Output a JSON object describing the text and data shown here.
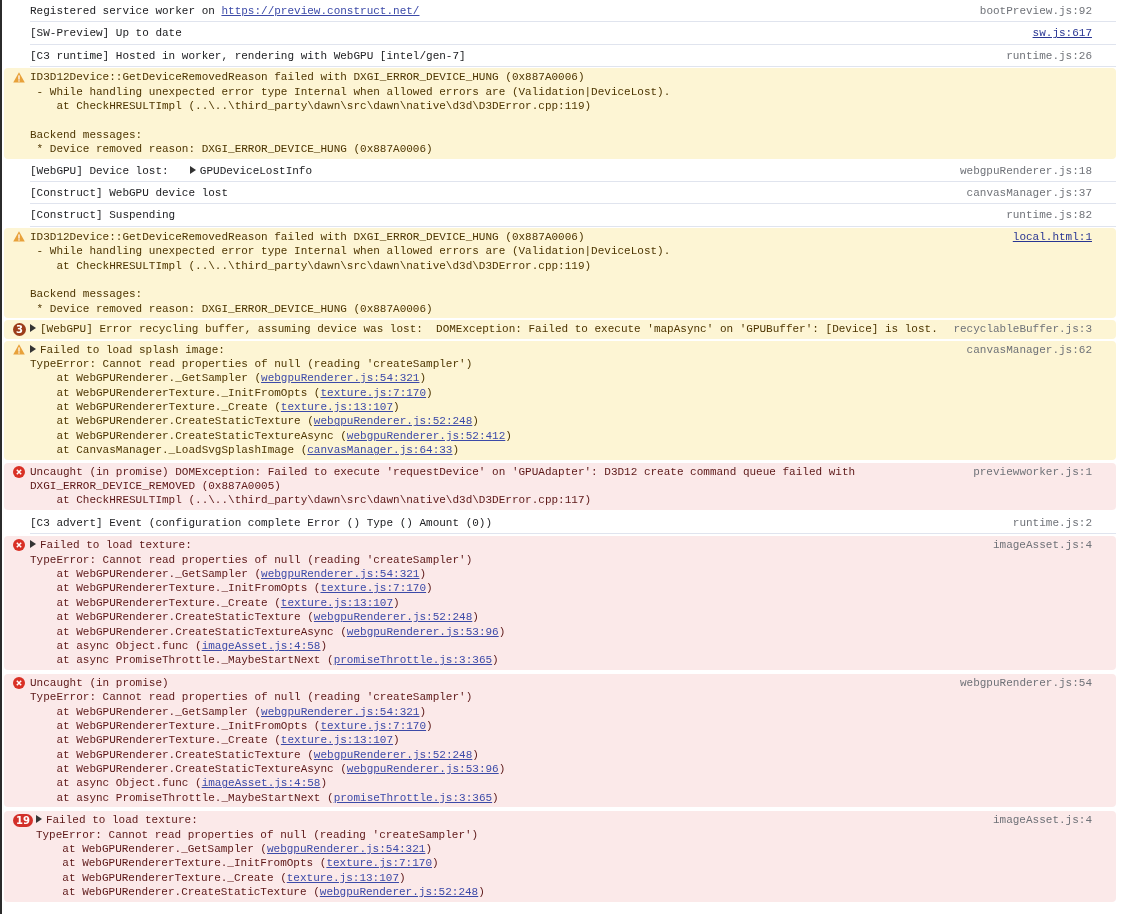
{
  "messages": [
    {
      "kind": "info",
      "paragraphs": [
        [
          [
            "Registered service worker on ",
            {
              "link": "https://preview.construct.net/"
            }
          ]
        ]
      ],
      "source": "bootPreview.js:92",
      "source_link": false
    },
    {
      "kind": "info",
      "paragraphs": [
        [
          [
            "[SW-Preview] Up to date"
          ]
        ]
      ],
      "source": "sw.js:617",
      "source_link": true
    },
    {
      "kind": "info",
      "paragraphs": [
        [
          [
            "[C3 runtime] Hosted in worker, rendering with WebGPU [intel/gen-7]"
          ]
        ]
      ],
      "source": "runtime.js:26",
      "source_link": false
    },
    {
      "kind": "warning",
      "paragraphs": [
        [
          [
            "ID3D12Device::GetDeviceRemovedReason failed with DXGI_ERROR_DEVICE_HUNG (0x887A0006)"
          ],
          [
            " - While handling unexpected error type Internal when allowed errors are (Validation|DeviceLost)."
          ],
          [
            "    at CheckHRESULTImpl (..\\..\\third_party\\dawn\\src\\dawn\\native\\d3d\\D3DError.cpp:119)"
          ]
        ],
        [
          [
            "Backend messages:"
          ],
          [
            " * Device removed reason: DXGI_ERROR_DEVICE_HUNG (0x887A0006)"
          ]
        ]
      ]
    },
    {
      "kind": "info",
      "paragraphs": [
        [
          [
            "[WebGPU] Device lost:  ",
            {
              "object": "GPUDeviceLostInfo",
              "expanded": false
            }
          ]
        ]
      ],
      "source": "webgpuRenderer.js:18",
      "source_link": false
    },
    {
      "kind": "info",
      "paragraphs": [
        [
          [
            "[Construct] WebGPU device lost"
          ]
        ]
      ],
      "source": "canvasManager.js:37",
      "source_link": false
    },
    {
      "kind": "info",
      "paragraphs": [
        [
          [
            "[Construct] Suspending"
          ]
        ]
      ],
      "source": "runtime.js:82",
      "source_link": false
    },
    {
      "kind": "warning",
      "paragraphs": [
        [
          [
            "ID3D12Device::GetDeviceRemovedReason failed with DXGI_ERROR_DEVICE_HUNG (0x887A0006)"
          ],
          [
            " - While handling unexpected error type Internal when allowed errors are (Validation|DeviceLost)."
          ],
          [
            "    at CheckHRESULTImpl (..\\..\\third_party\\dawn\\src\\dawn\\native\\d3d\\D3DError.cpp:119)"
          ]
        ],
        [
          [
            "Backend messages:"
          ],
          [
            " * Device removed reason: DXGI_ERROR_DEVICE_HUNG (0x887A0006)"
          ]
        ]
      ],
      "source": "local.html:1",
      "source_link": true
    },
    {
      "kind": "warning",
      "count": "3",
      "expanded": false,
      "paragraphs": [
        [
          [
            "[WebGPU] Error recycling buffer, assuming device was lost:  DOMException: Failed to execute 'mapAsync' on 'GPUBuffer': [Device] is lost."
          ]
        ]
      ],
      "source": "recyclableBuffer.js:3",
      "source_link": false
    },
    {
      "kind": "warning",
      "expanded": false,
      "paragraphs": [
        [
          [
            "Failed to load splash image:"
          ],
          [
            "TypeError: Cannot read properties of null (reading 'createSampler')"
          ],
          [
            "    at WebGPURenderer._GetSampler (",
            {
              "link": "webgpuRenderer.js:54:321"
            },
            ")"
          ],
          [
            "    at WebGPURendererTexture._InitFromOpts (",
            {
              "link": "texture.js:7:170"
            },
            ")"
          ],
          [
            "    at WebGPURendererTexture._Create (",
            {
              "link": "texture.js:13:107"
            },
            ")"
          ],
          [
            "    at WebGPURenderer.CreateStaticTexture (",
            {
              "link": "webgpuRenderer.js:52:248"
            },
            ")"
          ],
          [
            "    at WebGPURenderer.CreateStaticTextureAsync (",
            {
              "link": "webgpuRenderer.js:52:412"
            },
            ")"
          ],
          [
            "    at CanvasManager._LoadSvgSplashImage (",
            {
              "link": "canvasManager.js:64:33"
            },
            ")"
          ]
        ]
      ],
      "source": "canvasManager.js:62",
      "source_link": false
    },
    {
      "kind": "error",
      "paragraphs": [
        [
          [
            "Uncaught (in promise) DOMException: Failed to execute 'requestDevice' on 'GPUAdapter': D3D12 create command queue failed with"
          ],
          [
            "DXGI_ERROR_DEVICE_REMOVED (0x887A0005)"
          ],
          [
            "    at CheckHRESULTImpl (..\\..\\third_party\\dawn\\src\\dawn\\native\\d3d\\D3DError.cpp:117)"
          ]
        ]
      ],
      "source": "previewworker.js:1",
      "source_link": false
    },
    {
      "kind": "info",
      "paragraphs": [
        [
          [
            "[C3 advert] Event (configuration complete Error () Type () Amount (0))"
          ]
        ]
      ],
      "source": "runtime.js:2",
      "source_link": false
    },
    {
      "kind": "error",
      "expanded": false,
      "paragraphs": [
        [
          [
            "Failed to load texture:"
          ],
          [
            "TypeError: Cannot read properties of null (reading 'createSampler')"
          ],
          [
            "    at WebGPURenderer._GetSampler (",
            {
              "link": "webgpuRenderer.js:54:321"
            },
            ")"
          ],
          [
            "    at WebGPURendererTexture._InitFromOpts (",
            {
              "link": "texture.js:7:170"
            },
            ")"
          ],
          [
            "    at WebGPURendererTexture._Create (",
            {
              "link": "texture.js:13:107"
            },
            ")"
          ],
          [
            "    at WebGPURenderer.CreateStaticTexture (",
            {
              "link": "webgpuRenderer.js:52:248"
            },
            ")"
          ],
          [
            "    at WebGPURenderer.CreateStaticTextureAsync (",
            {
              "link": "webgpuRenderer.js:53:96"
            },
            ")"
          ],
          [
            "    at async Object.func (",
            {
              "link": "imageAsset.js:4:58"
            },
            ")"
          ],
          [
            "    at async PromiseThrottle._MaybeStartNext (",
            {
              "link": "promiseThrottle.js:3:365"
            },
            ")"
          ]
        ]
      ],
      "source": "imageAsset.js:4",
      "source_link": false
    },
    {
      "kind": "error",
      "paragraphs": [
        [
          [
            "Uncaught (in promise)"
          ],
          [
            "TypeError: Cannot read properties of null (reading 'createSampler')"
          ],
          [
            "    at WebGPURenderer._GetSampler (",
            {
              "link": "webgpuRenderer.js:54:321"
            },
            ")"
          ],
          [
            "    at WebGPURendererTexture._InitFromOpts (",
            {
              "link": "texture.js:7:170"
            },
            ")"
          ],
          [
            "    at WebGPURendererTexture._Create (",
            {
              "link": "texture.js:13:107"
            },
            ")"
          ],
          [
            "    at WebGPURenderer.CreateStaticTexture (",
            {
              "link": "webgpuRenderer.js:52:248"
            },
            ")"
          ],
          [
            "    at WebGPURenderer.CreateStaticTextureAsync (",
            {
              "link": "webgpuRenderer.js:53:96"
            },
            ")"
          ],
          [
            "    at async Object.func (",
            {
              "link": "imageAsset.js:4:58"
            },
            ")"
          ],
          [
            "    at async PromiseThrottle._MaybeStartNext (",
            {
              "link": "promiseThrottle.js:3:365"
            },
            ")"
          ]
        ]
      ],
      "source": "webgpuRenderer.js:54",
      "source_link": false
    },
    {
      "kind": "error",
      "count": "19",
      "expanded": false,
      "paragraphs": [
        [
          [
            "Failed to load texture:"
          ],
          [
            "TypeError: Cannot read properties of null (reading 'createSampler')"
          ],
          [
            "    at WebGPURenderer._GetSampler (",
            {
              "link": "webgpuRenderer.js:54:321"
            },
            ")"
          ],
          [
            "    at WebGPURendererTexture._InitFromOpts (",
            {
              "link": "texture.js:7:170"
            },
            ")"
          ],
          [
            "    at WebGPURendererTexture._Create (",
            {
              "link": "texture.js:13:107"
            },
            ")"
          ],
          [
            "    at WebGPURenderer.CreateStaticTexture (",
            {
              "link": "webgpuRenderer.js:52:248"
            },
            ")"
          ]
        ]
      ],
      "source": "imageAsset.js:4",
      "source_link": false
    }
  ]
}
